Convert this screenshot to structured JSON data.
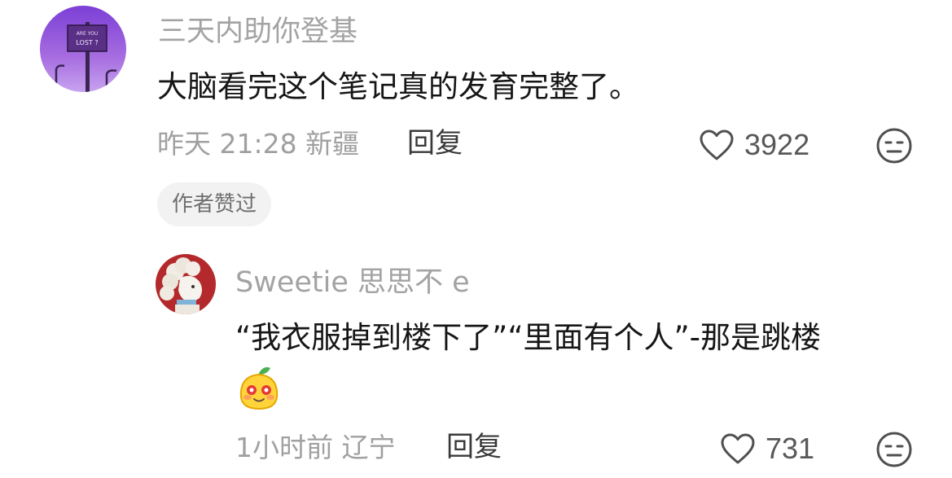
{
  "comment": {
    "username": "三天内助你登基",
    "text": "大脑看完这个笔记真的发育完整了。",
    "meta": "昨天 21:28 新疆",
    "reply_label": "回复",
    "likes": "3922",
    "author_badge": "作者赞过",
    "avatar_sign_line1": "ARE YOU",
    "avatar_sign_line2": "LOST ?"
  },
  "reply": {
    "username": "Sweetie 思思不 e",
    "text": "“我衣服掉到楼下了”“里面有个人”-那是跳楼",
    "meta": "1小时前 辽宁",
    "reply_label": "回复",
    "likes": "731"
  },
  "colors": {
    "muted": "#a3a3a3",
    "body": "#161616",
    "avatar_purple": "#a76de0"
  },
  "icons": {
    "like": "heart-outline-icon",
    "dislike": "meh-face-icon",
    "sticker": "yellow-cat-sticker-icon"
  }
}
